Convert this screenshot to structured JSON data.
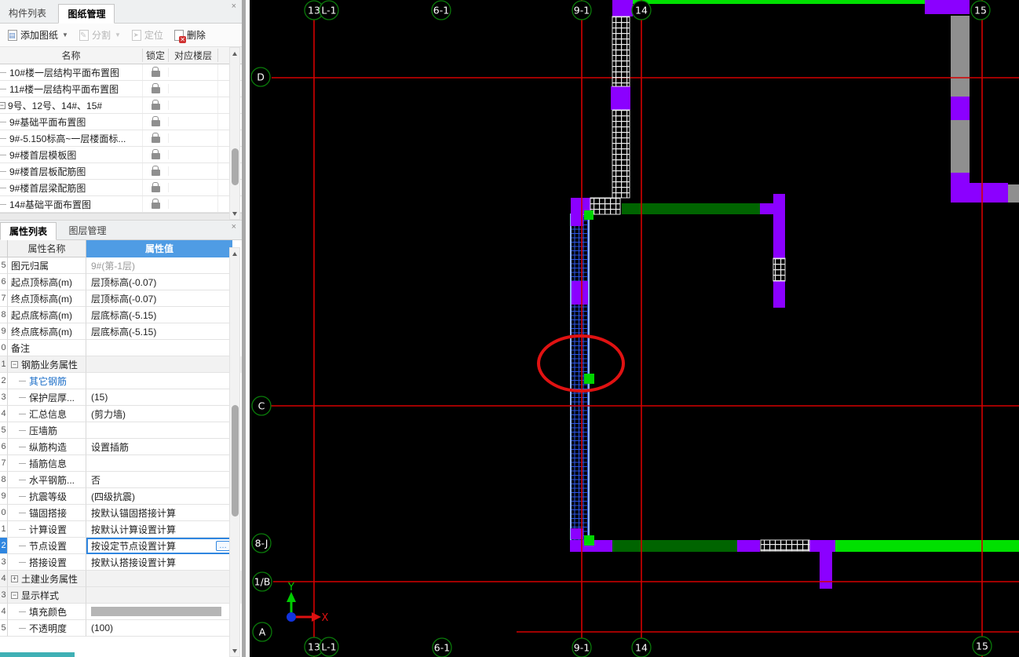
{
  "drawings_panel": {
    "tabs": [
      {
        "label": "构件列表"
      },
      {
        "label": "图纸管理"
      }
    ],
    "close_label": "×",
    "toolbar": [
      {
        "label": "添加图纸",
        "enabled": true,
        "dropdown": true
      },
      {
        "label": "分割",
        "enabled": false,
        "dropdown": true
      },
      {
        "label": "定位",
        "enabled": false,
        "dropdown": false
      },
      {
        "label": "删除",
        "enabled": true,
        "dropdown": false
      }
    ],
    "dropdown_caret": "▼",
    "columns": [
      "名称",
      "锁定",
      "对应楼层"
    ],
    "rows": [
      {
        "name": "10#楼一层结构平面布置图",
        "cls": "child",
        "locked": true
      },
      {
        "name": "11#楼一层结构平面布置图",
        "cls": "child",
        "locked": true
      },
      {
        "name": "9号、12号、14#、15#",
        "cls": "parent",
        "box": "−",
        "locked": true
      },
      {
        "name": "9#基础平面布置图",
        "cls": "child",
        "locked": true
      },
      {
        "name": "9#-5.150标高~一层楼面标...",
        "cls": "child",
        "locked": true
      },
      {
        "name": "9#楼首层模板图",
        "cls": "child",
        "locked": true
      },
      {
        "name": "9#楼首层板配筋图",
        "cls": "child",
        "locked": true
      },
      {
        "name": "9#楼首层梁配筋图",
        "cls": "child",
        "locked": true
      },
      {
        "name": "14#基础平面布置图",
        "cls": "child",
        "locked": true
      }
    ]
  },
  "properties_panel": {
    "tabs": [
      {
        "label": "属性列表"
      },
      {
        "label": "图层管理"
      }
    ],
    "close_label": "×",
    "columns": [
      "属性名称",
      "属性值"
    ],
    "rows": [
      {
        "num": "5",
        "name": "图元归属",
        "value": "9#(第-1层)",
        "cls": "top vgray"
      },
      {
        "num": "6",
        "name": "起点顶标高(m)",
        "value": "层顶标高(-0.07)",
        "cls": "top"
      },
      {
        "num": "7",
        "name": "终点顶标高(m)",
        "value": "层顶标高(-0.07)",
        "cls": "top"
      },
      {
        "num": "8",
        "name": "起点底标高(m)",
        "value": "层底标高(-5.15)",
        "cls": "top"
      },
      {
        "num": "9",
        "name": "终点底标高(m)",
        "value": "层底标高(-5.15)",
        "cls": "top"
      },
      {
        "num": "0",
        "name": "备注",
        "value": "",
        "cls": "top"
      },
      {
        "num": "1",
        "name": "钢筋业务属性",
        "value": "",
        "box": "−",
        "cls": "parent"
      },
      {
        "num": "2",
        "name": "其它钢筋",
        "value": "",
        "cls": "child link"
      },
      {
        "num": "3",
        "name": "保护层厚...",
        "value": "(15)",
        "cls": "child"
      },
      {
        "num": "4",
        "name": "汇总信息",
        "value": "(剪力墙)",
        "cls": "child"
      },
      {
        "num": "5",
        "name": "压墙筋",
        "value": "",
        "cls": "child"
      },
      {
        "num": "6",
        "name": "纵筋构造",
        "value": "设置插筋",
        "cls": "child"
      },
      {
        "num": "7",
        "name": "插筋信息",
        "value": "",
        "cls": "child"
      },
      {
        "num": "8",
        "name": "水平钢筋...",
        "value": "否",
        "cls": "child"
      },
      {
        "num": "9",
        "name": "抗震等级",
        "value": "(四级抗震)",
        "cls": "child"
      },
      {
        "num": "0",
        "name": "锚固搭接",
        "value": "按默认锚固搭接计算",
        "cls": "child"
      },
      {
        "num": "1",
        "name": "计算设置",
        "value": "按默认计算设置计算",
        "cls": "child"
      },
      {
        "num": "2",
        "name": "节点设置",
        "value": "按设定节点设置计算",
        "cls": "child selected",
        "btn": "…"
      },
      {
        "num": "3",
        "name": "搭接设置",
        "value": "按默认搭接设置计算",
        "cls": "child"
      },
      {
        "num": "4",
        "name": "土建业务属性",
        "value": "",
        "box": "+",
        "cls": "parent"
      },
      {
        "num": "3",
        "name": "显示样式",
        "value": "",
        "box": "−",
        "cls": "parent"
      },
      {
        "num": "4",
        "name": "填充颜色",
        "value": "",
        "cls": "child has-swatch"
      },
      {
        "num": "5",
        "name": "不透明度",
        "value": "(100)",
        "cls": "child"
      }
    ]
  },
  "canvas": {
    "bubbles": [
      {
        "label": "13"
      },
      {
        "label": "L-1"
      },
      {
        "label": "6-1"
      },
      {
        "label": "9-1"
      },
      {
        "label": "14"
      },
      {
        "label": "15"
      },
      {
        "label": "D"
      },
      {
        "label": "C"
      },
      {
        "label": "8-J"
      },
      {
        "label": "1/B"
      },
      {
        "label": "A"
      },
      {
        "label": "13"
      },
      {
        "label": "L-1"
      },
      {
        "label": "6-1"
      },
      {
        "label": "9-1"
      },
      {
        "label": "14"
      },
      {
        "label": "15"
      }
    ],
    "axis_indicator": {
      "x_label": "X",
      "y_label": "Y"
    },
    "colors": {
      "wall_purple": "#8b00ff",
      "wall_gray": "#8f8f8f",
      "beam_dark_green": "#006400",
      "beam_bright_green": "#00e000",
      "grid_line_red": "#d40000",
      "bubble_green": "#0a7a0a",
      "selection_blue": "#8fb2f2",
      "grip_green": "#00d400",
      "highlight_red": "#e01212"
    }
  }
}
